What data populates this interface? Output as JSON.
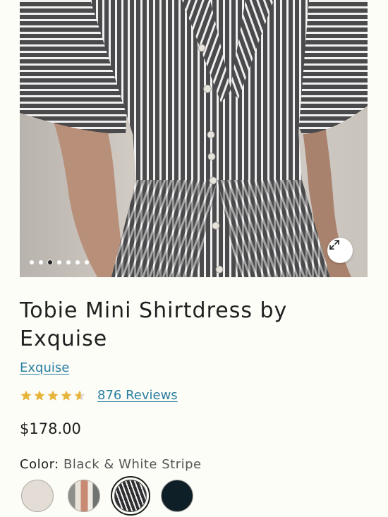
{
  "product": {
    "title": "Tobie Mini Shirtdress by Exquise",
    "brand": "Exquise",
    "rating": 4.6,
    "reviews_label": "876 Reviews",
    "price": "$178.00"
  },
  "gallery": {
    "dot_count": 7,
    "active_dot": 2,
    "expand_icon": "expand-arrows-icon"
  },
  "color": {
    "label": "Color:",
    "selected": "Black & White Stripe"
  },
  "swatches": [
    {
      "name": "swatch-ivory",
      "color": "#e3ddd6"
    },
    {
      "name": "swatch-multicolor-stripe",
      "color": "#c98a74"
    },
    {
      "name": "swatch-black-white-stripe",
      "color": "#3a3a3a",
      "selected": true
    },
    {
      "name": "swatch-navy",
      "color": "#0f1f28"
    }
  ],
  "colors": {
    "link": "#2a7ea0",
    "star": "#e7b43a",
    "background": "#fdfdf8"
  }
}
